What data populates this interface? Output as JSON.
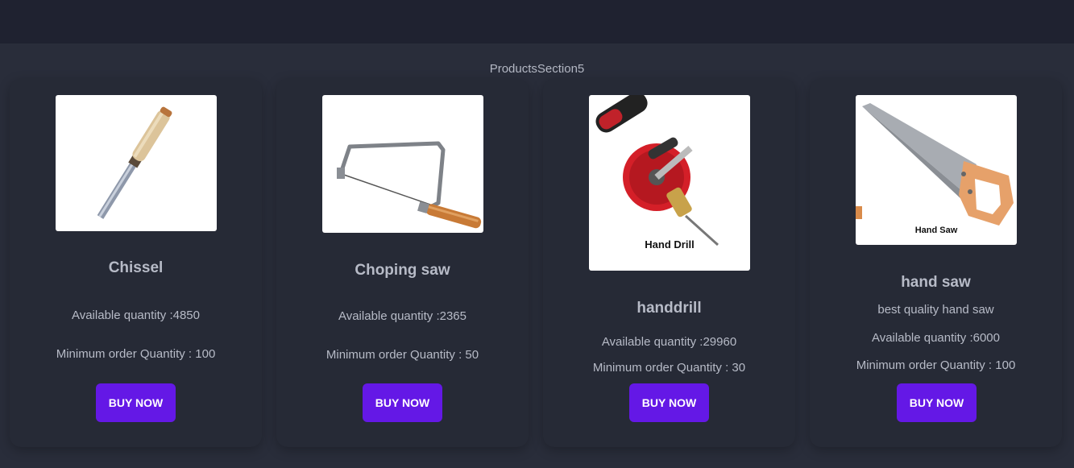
{
  "section": {
    "title": "ProductsSection5"
  },
  "products": [
    {
      "name": "Chissel",
      "description": "",
      "available": "Available quantity :4850",
      "minimum": "Minimum order Quantity : 100",
      "button": "BUY NOW",
      "icon": "chisel-image"
    },
    {
      "name": "Choping saw",
      "description": "",
      "available": "Available quantity :2365",
      "minimum": "Minimum order Quantity : 50",
      "button": "BUY NOW",
      "icon": "coping-saw-image"
    },
    {
      "name": "handdrill",
      "description": "",
      "image_label": "Hand Drill",
      "available": "Available quantity :29960",
      "minimum": "Minimum order Quantity : 30",
      "button": "BUY NOW",
      "icon": "hand-drill-image"
    },
    {
      "name": "hand saw",
      "description": "best quality hand saw",
      "image_label": "Hand Saw",
      "available": "Available quantity :6000",
      "minimum": "Minimum order Quantity : 100",
      "button": "BUY NOW",
      "icon": "hand-saw-image"
    }
  ],
  "colors": {
    "button": "#6418e6",
    "card": "#262a36",
    "background": "#292d3a",
    "topbar": "#1f2230"
  }
}
